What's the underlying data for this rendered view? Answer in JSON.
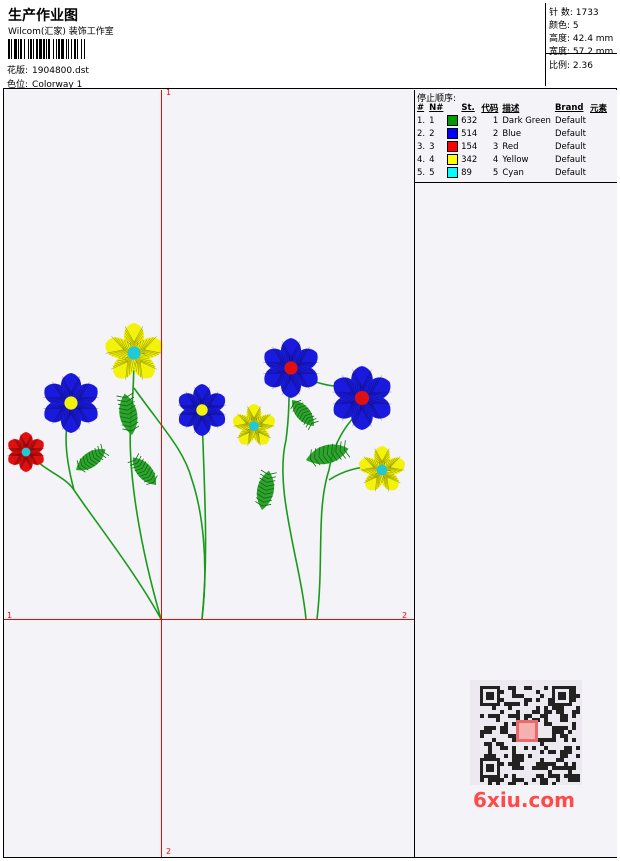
{
  "header": {
    "title": "生产作业图",
    "subtitle": "Wilcom(汇家) 装饰工作室",
    "design_label": "花版:",
    "design_file": "1904800.dst",
    "colorway_label": "色位:",
    "colorway": "Colorway 1"
  },
  "stats": {
    "stitches": "针 数: 1733",
    "colors": "颜色: 5",
    "height": "高度: 42.4 mm",
    "width": "宽度: 57.2 mm",
    "scale": "比例: 2.36"
  },
  "stop_sequence": {
    "title": "停止顺序:",
    "headers": [
      "#",
      "N#",
      "St.",
      "代码",
      "描述",
      "Brand",
      "元素"
    ],
    "rows": [
      {
        "n": "1.",
        "nn": "1",
        "color": "#009900",
        "st": "632",
        "code": "1",
        "desc": "Dark Green",
        "brand": "Default"
      },
      {
        "n": "2.",
        "nn": "2",
        "color": "#0000ff",
        "st": "514",
        "code": "2",
        "desc": "Blue",
        "brand": "Default"
      },
      {
        "n": "3.",
        "nn": "3",
        "color": "#ff0000",
        "st": "154",
        "code": "3",
        "desc": "Red",
        "brand": "Default"
      },
      {
        "n": "4.",
        "nn": "4",
        "color": "#ffff00",
        "st": "342",
        "code": "4",
        "desc": "Yellow",
        "brand": "Default"
      },
      {
        "n": "5.",
        "nn": "5",
        "color": "#00ffff",
        "st": "89",
        "code": "5",
        "desc": "Cyan",
        "brand": "Default"
      }
    ]
  },
  "axes": {
    "top_label": "1",
    "left_label": "1",
    "right_label": "2",
    "bottom_label": "2"
  },
  "watermark": "6xiu.com",
  "colors": {
    "axis": "#ff0000",
    "stem": "#1a9a1a",
    "blue": "#1a1adf",
    "yellow": "#f2f20a",
    "red": "#e01010",
    "cyan": "#22c8d8"
  }
}
